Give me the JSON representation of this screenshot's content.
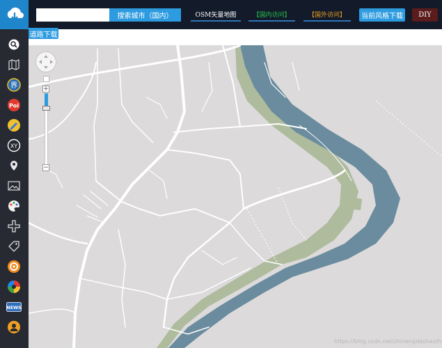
{
  "colors": {
    "topbar_bg": "#131a2a",
    "sidebar_bg": "#272a33",
    "accent": "#2d9be0",
    "map_land": "#dcdadb",
    "map_water": "#6a8c9e",
    "map_green": "#aebb9d",
    "map_road": "#ffffff"
  },
  "header": {
    "logo_icon": "cloud-download-icon",
    "search": {
      "value": "",
      "placeholder": "",
      "button_label": "搜索城市（国内）"
    },
    "nav": {
      "osm_label": "OSM矢量地图",
      "domestic_label": "【国内访问】",
      "foreign_label": "【国外访问】",
      "download_label": "当前风格下载",
      "diy_label": "DIY"
    }
  },
  "road_download_label": "道路下载",
  "sidebar": {
    "items": [
      {
        "icon": "search-icon"
      },
      {
        "icon": "map-icon"
      },
      {
        "icon": "boundary-icon",
        "label": "界"
      },
      {
        "icon": "poi-icon",
        "label": "Poi"
      },
      {
        "icon": "pencil-icon"
      },
      {
        "icon": "xy-coordinate-icon",
        "label": "XY"
      },
      {
        "icon": "location-pin-icon"
      },
      {
        "icon": "image-icon"
      },
      {
        "icon": "palette-icon"
      },
      {
        "icon": "road-cross-icon"
      },
      {
        "icon": "tag-icon"
      },
      {
        "icon": "settings-icon"
      },
      {
        "icon": "color-wheel-icon"
      },
      {
        "icon": "news-icon",
        "label": "NEWS"
      },
      {
        "icon": "user-icon"
      }
    ]
  },
  "map": {
    "zoom_in_label": "+",
    "zoom_out_label": "−",
    "zoom_level_fraction": 0.25
  },
  "watermark": "https://blog.csdn.net/zhinengdashao/ha"
}
